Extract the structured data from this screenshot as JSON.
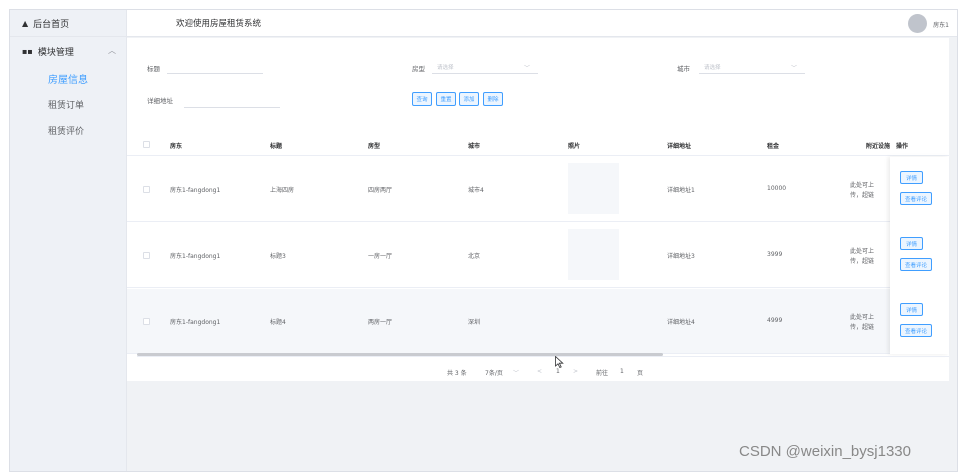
{
  "sidebar": {
    "home": {
      "icon": "home-icon",
      "label": "后台首页"
    },
    "group": {
      "icon": "grid-icon",
      "label": "模块管理",
      "expanded": true
    },
    "items": [
      {
        "label": "房屋信息",
        "active": true
      },
      {
        "label": "租赁订单",
        "active": false
      },
      {
        "label": "租赁评价",
        "active": false
      }
    ]
  },
  "header": {
    "title": "欢迎使用房屋租赁系统",
    "user": "房东1"
  },
  "filters": {
    "title_label": "标题",
    "type_label": "房型",
    "type_placeholder": "请选择",
    "city_label": "城市",
    "city_placeholder": "请选择",
    "address_label": "详细地址"
  },
  "buttons": {
    "query": "查询",
    "reset": "重置",
    "add": "添加",
    "delete": "删除"
  },
  "table": {
    "columns": [
      "房东",
      "标题",
      "房型",
      "城市",
      "照片",
      "详细地址",
      "租金",
      "附近设施",
      "操作"
    ],
    "rows": [
      {
        "landlord": "房东1-fangdong1",
        "title": "上海四房",
        "type": "四房两厅",
        "city": "城市4",
        "has_photo": true,
        "address": "详细地址1",
        "rent": "10000",
        "nearby": "此处可上传，超链"
      },
      {
        "landlord": "房东1-fangdong1",
        "title": "标题3",
        "type": "一房一厅",
        "city": "北京",
        "has_photo": true,
        "address": "详细地址3",
        "rent": "3999",
        "nearby": "此处可上传，超链"
      },
      {
        "landlord": "房东1-fangdong1",
        "title": "标题4",
        "type": "两房一厅",
        "city": "深圳",
        "has_photo": false,
        "address": "详细地址4",
        "rent": "4999",
        "nearby": "此处可上传，超链"
      }
    ],
    "row_actions": {
      "detail": "详情",
      "reviews": "查看评论"
    }
  },
  "pagination": {
    "total": "共 3 条",
    "page_size": "7条/页",
    "prev": "<",
    "current": "1",
    "next": ">",
    "goto_label": "前往",
    "goto_value": "1",
    "page_suffix": "页"
  },
  "watermark": "CSDN @weixin_bysj1330",
  "colors": {
    "accent": "#409eff",
    "sidebar_bg": "#eef1f6",
    "page_bg": "#f0f2f5"
  }
}
